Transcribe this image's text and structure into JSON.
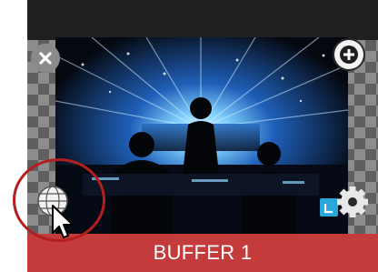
{
  "buffer": {
    "label": "BUFFER 1",
    "accent_color": "#c33b3b",
    "highlight_color": "#b41e1e"
  },
  "icons": {
    "close": "close-icon",
    "add": "plus-icon",
    "settings": "gear-icon",
    "live": "live-indicator-icon",
    "globe": "globe-icon",
    "cursor": "mouse-pointer-icon"
  }
}
